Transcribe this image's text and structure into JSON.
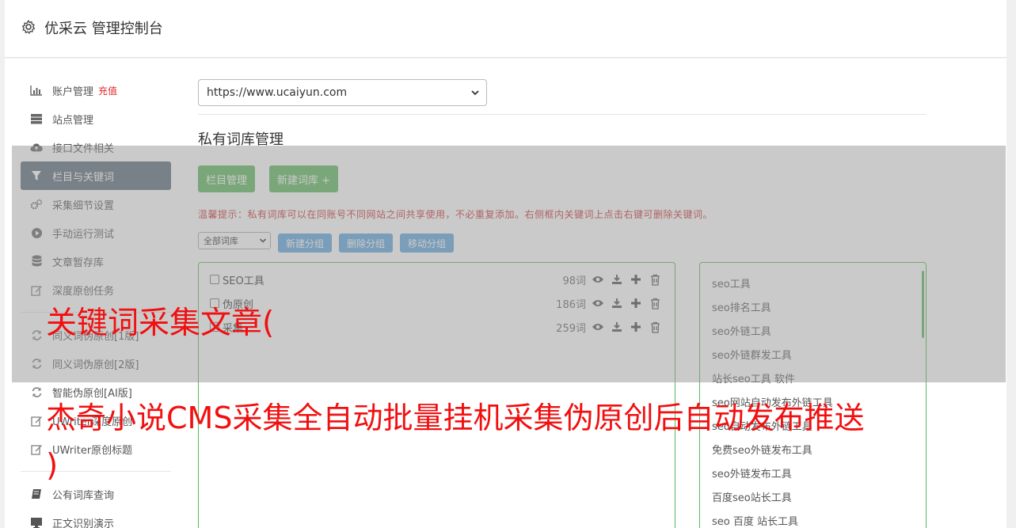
{
  "header": {
    "title": "优采云 管理控制台"
  },
  "sidebar": {
    "items": [
      {
        "label": "账户管理",
        "badge": "充值",
        "icon": "bar-chart-icon"
      },
      {
        "label": "站点管理",
        "icon": "server-icon"
      },
      {
        "label": "接口文件相关",
        "icon": "cloud-upload-icon"
      },
      {
        "label": "栏目与关键词",
        "icon": "filter-icon",
        "active": true
      },
      {
        "label": "采集细节设置",
        "icon": "gears-icon"
      },
      {
        "label": "手动运行测试",
        "icon": "play-circle-icon"
      },
      {
        "label": "文章暂存库",
        "icon": "database-icon"
      },
      {
        "label": "深度原创任务",
        "icon": "edit-icon"
      },
      {
        "label": "同义词伪原创[1版]",
        "icon": "refresh-icon"
      },
      {
        "label": "同义词伪原创[2版]",
        "icon": "refresh-icon"
      },
      {
        "label": "智能伪原创[AI版]",
        "icon": "refresh-icon"
      },
      {
        "label": "UWriter深度原创",
        "icon": "edit-icon"
      },
      {
        "label": "UWriter原创标题",
        "icon": "edit-icon"
      },
      {
        "label": "公有词库查询",
        "icon": "book-icon"
      },
      {
        "label": "正文识别演示",
        "icon": "monitor-icon"
      }
    ]
  },
  "main": {
    "site_select": "https://www.ucaiyun.com",
    "section_title": "私有词库管理",
    "buttons": {
      "column_manage": "栏目管理",
      "new_lexicon": "新建词库 +"
    },
    "tip": "温馨提示：私有词库可以在同账号不同网站之间共享使用，不必重复添加。右侧框内关键词上点击右键可删除关键词。",
    "group_select": "全部词库",
    "group_buttons": {
      "new_group": "新建分组",
      "delete_group": "删除分组",
      "move_group": "移动分组"
    },
    "lexicons": [
      {
        "name": "SEO工具",
        "count": "98词"
      },
      {
        "name": "伪原创",
        "count": "186词"
      },
      {
        "name": "采集",
        "count": "259词"
      }
    ],
    "keywords": [
      "seo工具",
      "seo排名工具",
      "seo外链工具",
      "seo外链群发工具",
      "站长seo工具 软件",
      "seo网站自动发布外链工具",
      "seo自动发布外链工具",
      "免费seo外链发布工具",
      "seo外链发布工具",
      "百度seo站长工具",
      "seo 百度 站长工具"
    ]
  },
  "overlay": {
    "line1": "关键词采集文章(",
    "line2": "杰奇小说CMS采集全自动批量挂机采集伪原创后自动发布推送",
    "line3": ")"
  },
  "colors": {
    "active_bg": "#5b6b7b",
    "green": "#5cb85c",
    "blue": "#5ea4dc",
    "tip_red": "#c9302c",
    "overlay_red": "#f20f10"
  }
}
